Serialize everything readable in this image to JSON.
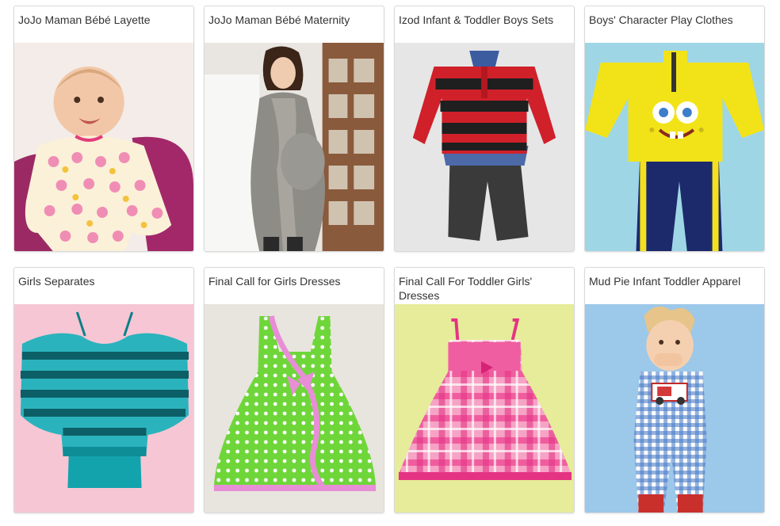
{
  "categories": [
    {
      "title": "JoJo Maman Bébé Layette",
      "image": "baby-in-floral-romper",
      "background": "#f3ece8"
    },
    {
      "title": "JoJo Maman Bébé Maternity",
      "image": "pregnant-woman-in-grey-wrap-cardigan",
      "background": "#e9e6e1"
    },
    {
      "title": "Izod Infant & Toddler Boys Sets",
      "image": "red-black-striped-sweater-and-grey-pants",
      "background": "#e6e6e6"
    },
    {
      "title": "Boys' Character Play Clothes",
      "image": "spongebob-yellow-top-and-navy-pants",
      "background": "#9fd6e6"
    },
    {
      "title": "Girls Separates",
      "image": "teal-sequin-striped-top",
      "background": "#f6c6d4"
    },
    {
      "title": "Final Call for Girls Dresses",
      "image": "green-polka-dot-dress",
      "background": "#e8e4de"
    },
    {
      "title": "Final Call For Toddler Girls' Dresses",
      "image": "pink-plaid-sundress",
      "background": "#e6ec9a"
    },
    {
      "title": "Mud Pie Infant Toddler Apparel",
      "image": "toddler-in-blue-gingham-romper",
      "background": "#9cc8ea"
    }
  ]
}
